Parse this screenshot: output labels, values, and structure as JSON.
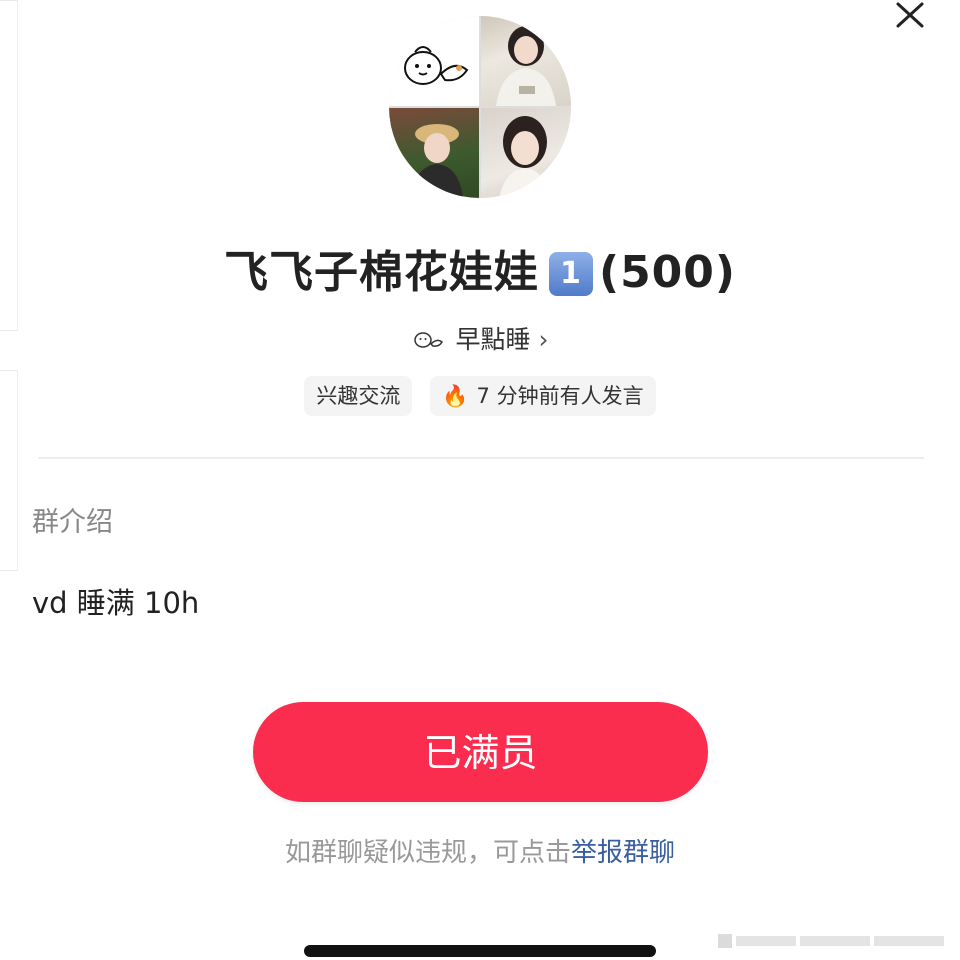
{
  "header": {
    "close_icon": "close-icon"
  },
  "group": {
    "name": "飞飞子棉花娃娃",
    "number_badge": "1",
    "member_count": "(500)"
  },
  "owner": {
    "name": "早點睡",
    "chevron": "›"
  },
  "tags": [
    {
      "label": "兴趣交流"
    },
    {
      "icon": "🔥",
      "label": "7 分钟前有人发言"
    }
  ],
  "intro": {
    "label": "群介绍",
    "text": "vd 睡满 10h"
  },
  "action": {
    "button_label": "已满员",
    "button_color": "#fb2d4f"
  },
  "report": {
    "prefix": "如群聊疑似违规，可点击",
    "link": "举报群聊",
    "link_color": "#3a5fa0"
  }
}
